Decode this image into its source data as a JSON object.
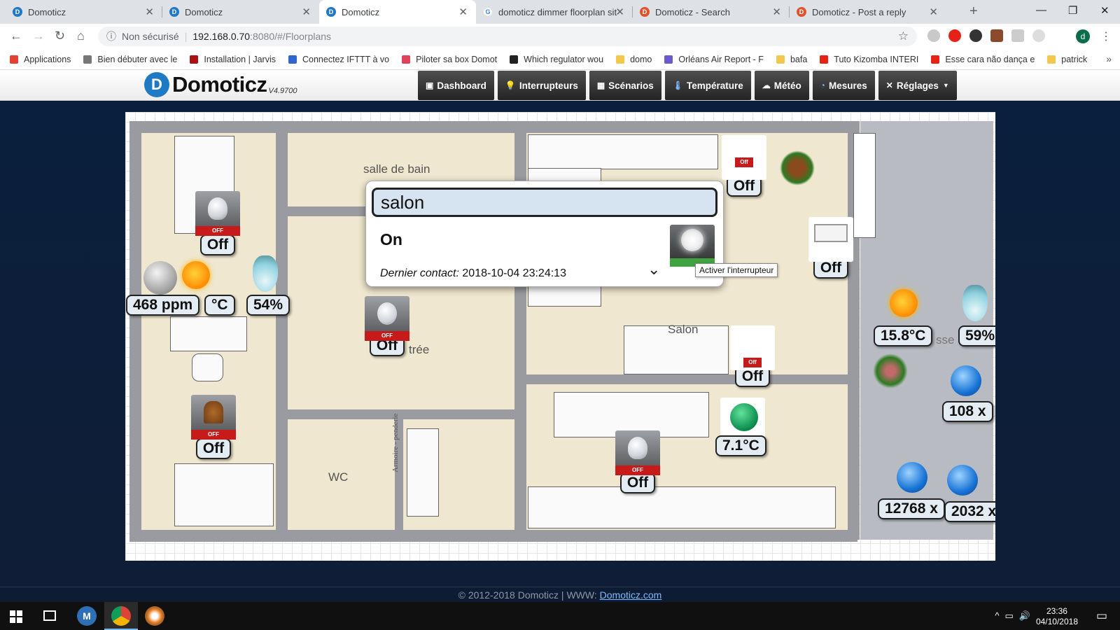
{
  "browser": {
    "tabs": [
      {
        "title": "Domoticz",
        "favicon_color": "#1f79c5",
        "active": false
      },
      {
        "title": "Domoticz",
        "favicon_color": "#1f79c5",
        "active": false
      },
      {
        "title": "Domoticz",
        "favicon_color": "#1f79c5",
        "active": true
      },
      {
        "title": "domoticz dimmer floorplan sit",
        "favicon_color": "#4285f4",
        "active": false
      },
      {
        "title": "Domoticz - Search",
        "favicon_color": "#e0542c",
        "active": false
      },
      {
        "title": "Domoticz - Post a reply",
        "favicon_color": "#e0542c",
        "active": false
      }
    ],
    "security": "Non sécurisé",
    "url_host": "192.168.0.70",
    "url_path": ":8080/#/Floorplans",
    "bookmarks": [
      {
        "label": "Applications",
        "color": "#e34133"
      },
      {
        "label": "Bien débuter avec le",
        "color": "#777"
      },
      {
        "label": "Installation | Jarvis",
        "color": "#a11"
      },
      {
        "label": "Connectez IFTTT à vo",
        "color": "#3366cc"
      },
      {
        "label": "Piloter sa box Domot",
        "color": "#e0425a"
      },
      {
        "label": "Which regulator wou",
        "color": "#222"
      },
      {
        "label": "domo",
        "color": "#f2c94c"
      },
      {
        "label": "Orléans Air Report - F",
        "color": "#6a5acd"
      },
      {
        "label": "bafa",
        "color": "#f2c94c"
      },
      {
        "label": "Tuto Kizomba INTERI",
        "color": "#e62117"
      },
      {
        "label": "Esse cara não dança e",
        "color": "#e62117"
      },
      {
        "label": "patrick",
        "color": "#f2c94c"
      }
    ],
    "avatar_letter": "d"
  },
  "app": {
    "logo_text": "Domoticz",
    "version": "V4.9700",
    "nav": [
      {
        "label": "Dashboard",
        "icon": "dashboard-icon"
      },
      {
        "label": "Interrupteurs",
        "icon": "bulb-icon"
      },
      {
        "label": "Scénarios",
        "icon": "clapper-icon"
      },
      {
        "label": "Température",
        "icon": "thermometer-icon"
      },
      {
        "label": "Météo",
        "icon": "cloud-icon"
      },
      {
        "label": "Mesures",
        "icon": "gauge-icon"
      },
      {
        "label": "Réglages",
        "icon": "tools-icon"
      }
    ]
  },
  "floorplan": {
    "rooms": [
      "salle de bain",
      "Salon",
      "WC",
      "Armoire - penderie",
      "trée"
    ],
    "devices": [
      {
        "label": "Off",
        "type": "bulb"
      },
      {
        "label": "Off",
        "type": "bulb"
      },
      {
        "label": "Off",
        "type": "lamp"
      },
      {
        "label": "Off",
        "type": "bulb"
      },
      {
        "label": "Off",
        "type": "floor-lamp"
      },
      {
        "label": "Off",
        "type": "floor-lamp"
      },
      {
        "label": "Off",
        "type": "screen"
      }
    ],
    "sensors": [
      {
        "label": "468 ppm",
        "type": "air-quality"
      },
      {
        "label": "°C",
        "type": "temperature"
      },
      {
        "label": "54%",
        "type": "humidity"
      },
      {
        "label": "15.8°C",
        "type": "temperature"
      },
      {
        "label": "59%",
        "type": "humidity"
      },
      {
        "label": "108 x",
        "type": "counter"
      },
      {
        "label": "7.1°C",
        "type": "temperature"
      },
      {
        "label": "12768 x",
        "type": "counter"
      },
      {
        "label": "2032 x",
        "type": "counter"
      }
    ],
    "truncated_label": "sse"
  },
  "popup": {
    "name": "salon",
    "status": "On",
    "contact_label": "Dernier contact:",
    "contact_value": "2018-10-04 23:24:13",
    "tooltip": "Activer l'interrupteur"
  },
  "footer": {
    "copyright": "© 2012-2018 Domoticz | WWW: ",
    "link": "Domoticz.com"
  },
  "taskbar": {
    "time": "23:36",
    "date": "04/10/2018"
  }
}
